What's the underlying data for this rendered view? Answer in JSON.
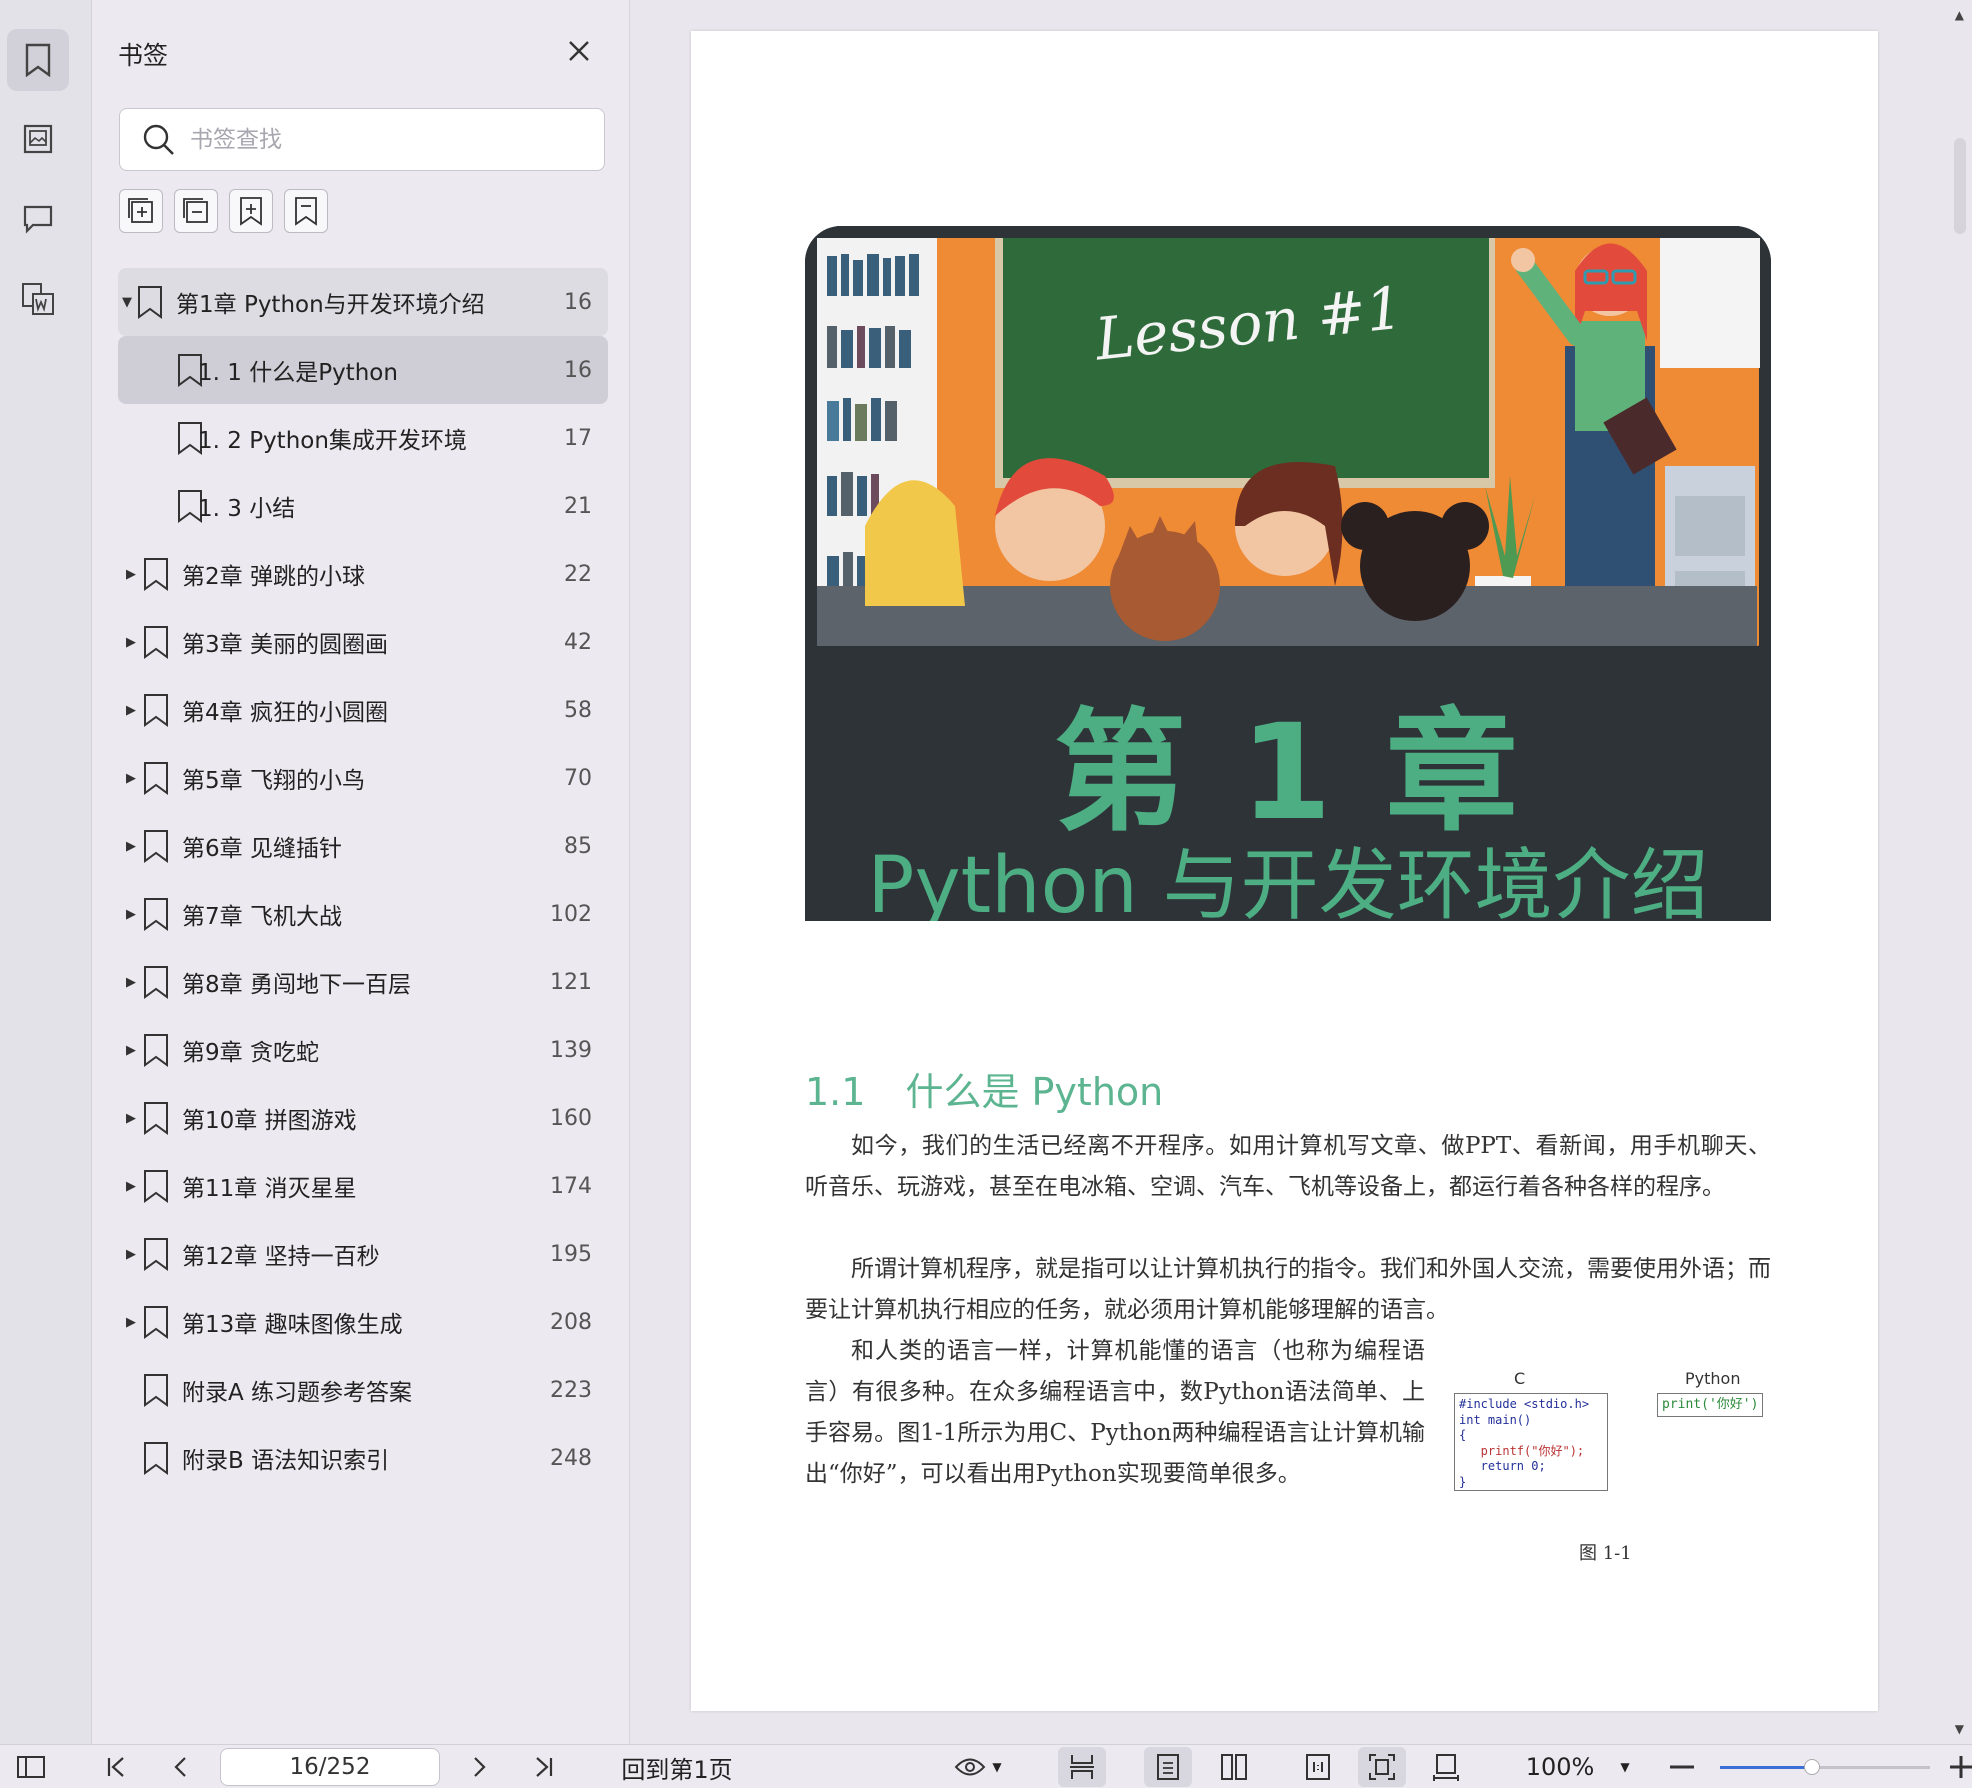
{
  "panel": {
    "title": "书签",
    "search_placeholder": "书签查找"
  },
  "bookmarks": [
    {
      "label": "第1章 Python与开发环境介绍",
      "page": "16",
      "level": 0,
      "expandable": true,
      "expanded": true
    },
    {
      "label": "1. 1   什么是Python",
      "page": "16",
      "level": 1,
      "expandable": false,
      "selected": true
    },
    {
      "label": "1. 2   Python集成开发环境",
      "page": "17",
      "level": 1,
      "expandable": false
    },
    {
      "label": "1. 3   小结",
      "page": "21",
      "level": 1,
      "expandable": false
    },
    {
      "label": "第2章 弹跳的小球",
      "page": "22",
      "level": 0,
      "expandable": true
    },
    {
      "label": "第3章 美丽的圆圈画",
      "page": "42",
      "level": 0,
      "expandable": true
    },
    {
      "label": "第4章 疯狂的小圆圈",
      "page": "58",
      "level": 0,
      "expandable": true
    },
    {
      "label": "第5章 飞翔的小鸟",
      "page": "70",
      "level": 0,
      "expandable": true
    },
    {
      "label": "第6章 见缝插针",
      "page": "85",
      "level": 0,
      "expandable": true
    },
    {
      "label": "第7章 飞机大战",
      "page": "102",
      "level": 0,
      "expandable": true
    },
    {
      "label": "第8章 勇闯地下一百层",
      "page": "121",
      "level": 0,
      "expandable": true
    },
    {
      "label": "第9章 贪吃蛇",
      "page": "139",
      "level": 0,
      "expandable": true
    },
    {
      "label": "第10章 拼图游戏",
      "page": "160",
      "level": 0,
      "expandable": true
    },
    {
      "label": "第11章 消灭星星",
      "page": "174",
      "level": 0,
      "expandable": true
    },
    {
      "label": "第12章 坚持一百秒",
      "page": "195",
      "level": 0,
      "expandable": true
    },
    {
      "label": "第13章 趣味图像生成",
      "page": "208",
      "level": 0,
      "expandable": true
    },
    {
      "label": "附录A 练习题参考答案",
      "page": "223",
      "level": 0,
      "expandable": false
    },
    {
      "label": "附录B 语法知识索引",
      "page": "248",
      "level": 0,
      "expandable": false
    }
  ],
  "document": {
    "banner_image": "classroom-illustration",
    "chapter_title": "第 1 章",
    "chapter_subtitle": "Python 与开发环境介绍",
    "blackboard_text": "Lesson #1",
    "section_number": "1.1",
    "section_title": "什么是 Python",
    "paragraph1": "如今，我们的生活已经离不开程序。如用计算机写文章、做PPT、看新闻，用手机聊天、听音乐、玩游戏，甚至在电冰箱、空调、汽车、飞机等设备上，都运行着各种各样的程序。",
    "paragraph2": "所谓计算机程序，就是指可以让计算机执行的指令。我们和外国人交流，需要使用外语；而要让计算机执行相应的任务，就必须用计算机能够理解的语言。",
    "paragraph3": "和人类的语言一样，计算机能懂的语言（也称为编程语言）有很多种。在众多编程语言中，数Python语法简单、上手容易。图1-1所示为用C、Python两种编程语言让计算机输出“你好”，可以看出用Python实现要简单很多。",
    "figure": {
      "label_c": "C",
      "label_python": "Python",
      "code_c_1": "#include <stdio.h>",
      "code_c_2": "int main()",
      "code_c_3": "{",
      "code_c_4": "   printf(\"你好\");",
      "code_c_5": "   return 0;",
      "code_c_6": "}",
      "code_python": "print('你好')",
      "caption": "图 1-1"
    }
  },
  "statusbar": {
    "page_indicator": "16/252",
    "goto_first": "回到第1页",
    "zoom": "100%",
    "zoom_fraction": 0.44
  },
  "colors": {
    "accent_green": "#4cae82",
    "banner_dark": "#2e3338",
    "slider_blue": "#3a6fd8"
  }
}
